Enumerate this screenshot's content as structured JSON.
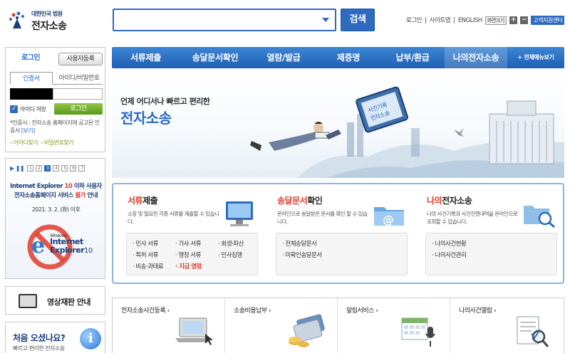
{
  "header": {
    "logo_small": "대한민국 법원",
    "logo_big": "전자소송",
    "search_placeholder": "",
    "search_button": "검색",
    "util_links": [
      "로그인",
      "|",
      "사이트맵",
      "|",
      "ENGLISH"
    ],
    "font_size_label": "화면크기",
    "font_plus": "+",
    "font_minus": "−",
    "help_center": "고객지원센터"
  },
  "nav": {
    "items": [
      "서류제출",
      "송달문서확인",
      "열람/발급",
      "제증명",
      "납부/환급",
      "나의전자소송",
      "+ 전체메뉴보기"
    ]
  },
  "login": {
    "tab_login": "로그인",
    "join_button": "사용자등록",
    "subtab_cert": "인증서",
    "subtab_id": "아이디/비밀번호",
    "save_label": "아이디 저장",
    "login_button": "로그인",
    "note_text": "*인증서 : 전자소송 홈페이지에 공고된 인증서",
    "note_link": "[보기]",
    "find_id": "› 아이디찾기",
    "find_pw": "› 비밀번호찾기"
  },
  "notice": {
    "controls": "▶ ❚❚",
    "pages": [
      "1",
      "2",
      "3",
      "4",
      "5",
      "6",
      "7"
    ],
    "active_page": 3,
    "line1_a": "Internet Explorer ",
    "line1_num": "10",
    "line1_b": " 이하 사용자",
    "line2_a": "전자소송홈페이지 서비스 ",
    "line2_red": "불가",
    "line2_b": " 안내",
    "date": "2021. 3. 2. (화) 이후",
    "ie_small": "Windows",
    "ie_name1": "Internet",
    "ie_name2": "Explorer",
    "ie_ver": "10"
  },
  "video": {
    "label": "영상재판 안내"
  },
  "first_visit": {
    "title": "처음 오셨나요?",
    "subtitle": "빠르고 편리한 전자소송",
    "info_glyph": "i"
  },
  "banner": {
    "heading_small": "언제 어디서나 빠르고 편리한",
    "heading_big": "전자소송",
    "monitor_text1": "사건기록",
    "monitor_text2": "전자소송"
  },
  "services": [
    {
      "title_a": "서류",
      "title_b": "제출",
      "desc": "소장 및 필요한 각종 서류를 제출할 수 있습니다.",
      "items": [
        "· 민사 서류",
        "· 가사 서류",
        "· 회생·파산",
        "· 특허 서류",
        "· 행정 서류",
        "· 민사집행",
        "· 비송·과태료",
        "· 지급 명령"
      ]
    },
    {
      "title_a": "송달문서",
      "title_b": "확인",
      "desc": "온라인으로 송달받은 문서를 확인 할 수 있습니다.",
      "items": [
        "· 전체송달문서",
        "· 미확인송달문서"
      ]
    },
    {
      "title_a": "나의",
      "title_b": "전자소송",
      "desc": "나의 사건기록과 사건진행내역을 온라인으로 조회할 수 있습니다.",
      "items": [
        "· 나의사건현황",
        "· 나의사건관리"
      ]
    }
  ],
  "quick": [
    "전자소송사건등록 ›",
    "소송비용납부 ›",
    "알림서비스 ›",
    "나의사건열람 ›"
  ],
  "colors": {
    "brand_blue": "#2d6ac0",
    "accent_red": "#e03c2c",
    "green": "#6aaa2a"
  }
}
